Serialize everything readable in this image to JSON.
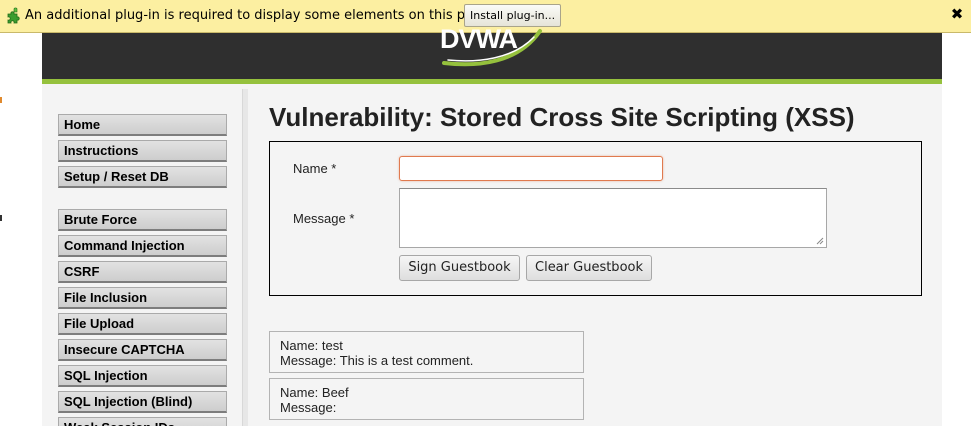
{
  "plugin_bar": {
    "message": "An additional plug-in is required to display some elements on this page.",
    "install_label": "Install plug-in...",
    "close_label": "✖",
    "icon": "puzzle-piece-icon"
  },
  "header": {
    "logo_text": "DVWA",
    "accent_color": "#95c13d"
  },
  "menu": {
    "group1": [
      "Home",
      "Instructions",
      "Setup / Reset DB"
    ],
    "group2": [
      "Brute Force",
      "Command Injection",
      "CSRF",
      "File Inclusion",
      "File Upload",
      "Insecure CAPTCHA",
      "SQL Injection",
      "SQL Injection (Blind)",
      "Weak Session IDs"
    ]
  },
  "main": {
    "title": "Vulnerability: Stored Cross Site Scripting (XSS)",
    "form": {
      "name_label": "Name *",
      "message_label": "Message *",
      "name_value": "",
      "message_value": "",
      "sign_button": "Sign Guestbook",
      "clear_button": "Clear Guestbook"
    },
    "entries": [
      {
        "name": "Name: test",
        "message": "Message: This is a test comment."
      },
      {
        "name": "Name: Beef",
        "message": "Message:"
      }
    ]
  }
}
